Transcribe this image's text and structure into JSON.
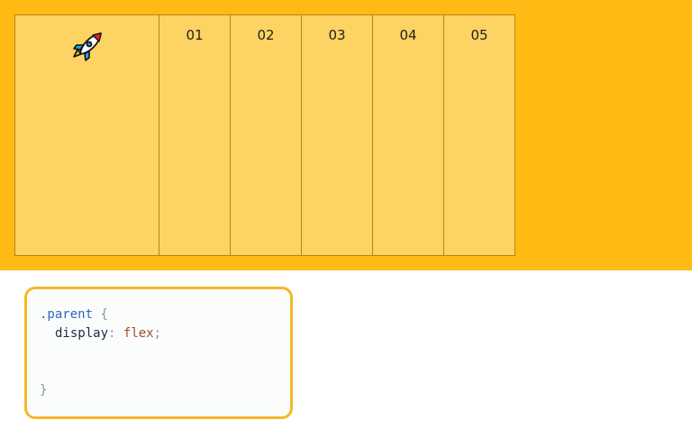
{
  "demo": {
    "items": [
      "01",
      "02",
      "03",
      "04",
      "05"
    ],
    "first_item_icon": "rocket-icon",
    "colors": {
      "background": "#FFBB14",
      "item_fill": "#FDD364",
      "item_border": "#B7860F"
    }
  },
  "code": {
    "selector": ".parent",
    "open_brace": "{",
    "property": "display",
    "colon": ":",
    "value": "flex",
    "semicolon": ";",
    "close_brace": "}",
    "colors": {
      "border": "#F6B826",
      "selector": "#2F68B5",
      "value": "#A34A2E"
    }
  }
}
